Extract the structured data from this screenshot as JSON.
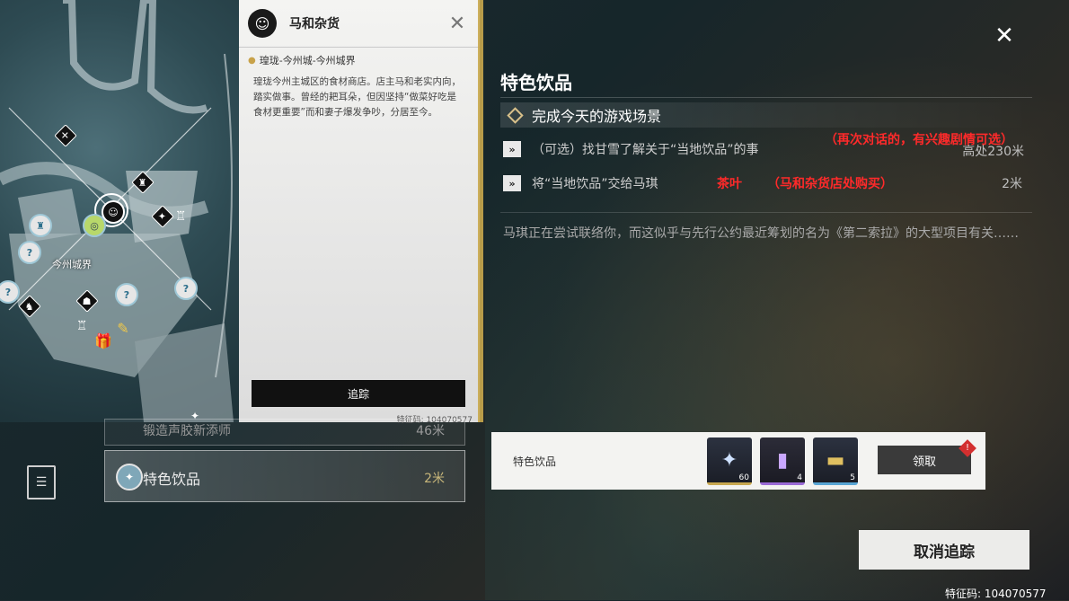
{
  "shop": {
    "name": "马和杂货",
    "location": "瑝珑-今州城-今州城界",
    "description": "瑝珑今州主城区的食材商店。店主马和老实内向，踏实做事。曾经的耙耳朵，但因坚持“做菜好吃是食材更重要”而和妻子爆发争吵，分居至今。",
    "track_label": "追踪",
    "code": "特征码: 104070577"
  },
  "map": {
    "area_label": "今州城界"
  },
  "quest": {
    "title": "特色饮品",
    "main_objective": "完成今天的游戏场景",
    "objectives": [
      {
        "text": "（可选）找甘雪了解关于“当地饮品”的事",
        "distance": "高处230米"
      },
      {
        "text": "将“当地饮品”交给马琪",
        "distance": "2米"
      }
    ],
    "annotations": {
      "note1": "（再次对话的，有兴趣剧情可选）",
      "note2": "茶叶",
      "note3": "（马和杂货店处购买）"
    },
    "description": "马琪正在尝试联络你，而这似乎与先行公约最近筹划的名为《第二索拉》的大型项目有关……"
  },
  "reward": {
    "label": "特色饮品",
    "items": [
      {
        "icon": "star-shard-icon",
        "count": "60"
      },
      {
        "icon": "purple-tube-icon",
        "count": "4"
      },
      {
        "icon": "gold-canister-icon",
        "count": "5"
      }
    ],
    "claim_label": "领取",
    "badge": "!"
  },
  "list": {
    "previous_item": "锻造声胶新添师",
    "previous_distance": "46米",
    "current_name": "特色饮品",
    "current_distance": "2米"
  },
  "cancel_label": "取消追踪",
  "code": "特征码: 104070577"
}
